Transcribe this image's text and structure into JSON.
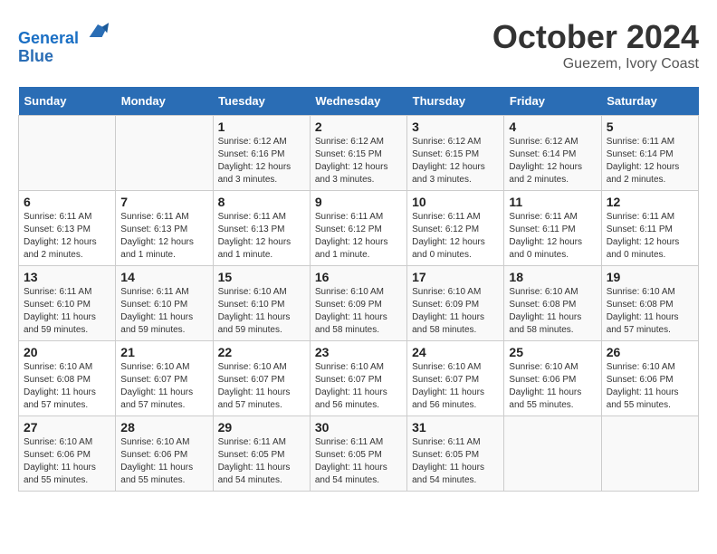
{
  "header": {
    "logo_line1": "General",
    "logo_line2": "Blue",
    "month": "October 2024",
    "location": "Guezem, Ivory Coast"
  },
  "weekdays": [
    "Sunday",
    "Monday",
    "Tuesday",
    "Wednesday",
    "Thursday",
    "Friday",
    "Saturday"
  ],
  "weeks": [
    [
      {
        "day": "",
        "sunrise": "",
        "sunset": "",
        "daylight": ""
      },
      {
        "day": "",
        "sunrise": "",
        "sunset": "",
        "daylight": ""
      },
      {
        "day": "1",
        "sunrise": "Sunrise: 6:12 AM",
        "sunset": "Sunset: 6:16 PM",
        "daylight": "Daylight: 12 hours and 3 minutes."
      },
      {
        "day": "2",
        "sunrise": "Sunrise: 6:12 AM",
        "sunset": "Sunset: 6:15 PM",
        "daylight": "Daylight: 12 hours and 3 minutes."
      },
      {
        "day": "3",
        "sunrise": "Sunrise: 6:12 AM",
        "sunset": "Sunset: 6:15 PM",
        "daylight": "Daylight: 12 hours and 3 minutes."
      },
      {
        "day": "4",
        "sunrise": "Sunrise: 6:12 AM",
        "sunset": "Sunset: 6:14 PM",
        "daylight": "Daylight: 12 hours and 2 minutes."
      },
      {
        "day": "5",
        "sunrise": "Sunrise: 6:11 AM",
        "sunset": "Sunset: 6:14 PM",
        "daylight": "Daylight: 12 hours and 2 minutes."
      }
    ],
    [
      {
        "day": "6",
        "sunrise": "Sunrise: 6:11 AM",
        "sunset": "Sunset: 6:13 PM",
        "daylight": "Daylight: 12 hours and 2 minutes."
      },
      {
        "day": "7",
        "sunrise": "Sunrise: 6:11 AM",
        "sunset": "Sunset: 6:13 PM",
        "daylight": "Daylight: 12 hours and 1 minute."
      },
      {
        "day": "8",
        "sunrise": "Sunrise: 6:11 AM",
        "sunset": "Sunset: 6:13 PM",
        "daylight": "Daylight: 12 hours and 1 minute."
      },
      {
        "day": "9",
        "sunrise": "Sunrise: 6:11 AM",
        "sunset": "Sunset: 6:12 PM",
        "daylight": "Daylight: 12 hours and 1 minute."
      },
      {
        "day": "10",
        "sunrise": "Sunrise: 6:11 AM",
        "sunset": "Sunset: 6:12 PM",
        "daylight": "Daylight: 12 hours and 0 minutes."
      },
      {
        "day": "11",
        "sunrise": "Sunrise: 6:11 AM",
        "sunset": "Sunset: 6:11 PM",
        "daylight": "Daylight: 12 hours and 0 minutes."
      },
      {
        "day": "12",
        "sunrise": "Sunrise: 6:11 AM",
        "sunset": "Sunset: 6:11 PM",
        "daylight": "Daylight: 12 hours and 0 minutes."
      }
    ],
    [
      {
        "day": "13",
        "sunrise": "Sunrise: 6:11 AM",
        "sunset": "Sunset: 6:10 PM",
        "daylight": "Daylight: 11 hours and 59 minutes."
      },
      {
        "day": "14",
        "sunrise": "Sunrise: 6:11 AM",
        "sunset": "Sunset: 6:10 PM",
        "daylight": "Daylight: 11 hours and 59 minutes."
      },
      {
        "day": "15",
        "sunrise": "Sunrise: 6:10 AM",
        "sunset": "Sunset: 6:10 PM",
        "daylight": "Daylight: 11 hours and 59 minutes."
      },
      {
        "day": "16",
        "sunrise": "Sunrise: 6:10 AM",
        "sunset": "Sunset: 6:09 PM",
        "daylight": "Daylight: 11 hours and 58 minutes."
      },
      {
        "day": "17",
        "sunrise": "Sunrise: 6:10 AM",
        "sunset": "Sunset: 6:09 PM",
        "daylight": "Daylight: 11 hours and 58 minutes."
      },
      {
        "day": "18",
        "sunrise": "Sunrise: 6:10 AM",
        "sunset": "Sunset: 6:08 PM",
        "daylight": "Daylight: 11 hours and 58 minutes."
      },
      {
        "day": "19",
        "sunrise": "Sunrise: 6:10 AM",
        "sunset": "Sunset: 6:08 PM",
        "daylight": "Daylight: 11 hours and 57 minutes."
      }
    ],
    [
      {
        "day": "20",
        "sunrise": "Sunrise: 6:10 AM",
        "sunset": "Sunset: 6:08 PM",
        "daylight": "Daylight: 11 hours and 57 minutes."
      },
      {
        "day": "21",
        "sunrise": "Sunrise: 6:10 AM",
        "sunset": "Sunset: 6:07 PM",
        "daylight": "Daylight: 11 hours and 57 minutes."
      },
      {
        "day": "22",
        "sunrise": "Sunrise: 6:10 AM",
        "sunset": "Sunset: 6:07 PM",
        "daylight": "Daylight: 11 hours and 57 minutes."
      },
      {
        "day": "23",
        "sunrise": "Sunrise: 6:10 AM",
        "sunset": "Sunset: 6:07 PM",
        "daylight": "Daylight: 11 hours and 56 minutes."
      },
      {
        "day": "24",
        "sunrise": "Sunrise: 6:10 AM",
        "sunset": "Sunset: 6:07 PM",
        "daylight": "Daylight: 11 hours and 56 minutes."
      },
      {
        "day": "25",
        "sunrise": "Sunrise: 6:10 AM",
        "sunset": "Sunset: 6:06 PM",
        "daylight": "Daylight: 11 hours and 55 minutes."
      },
      {
        "day": "26",
        "sunrise": "Sunrise: 6:10 AM",
        "sunset": "Sunset: 6:06 PM",
        "daylight": "Daylight: 11 hours and 55 minutes."
      }
    ],
    [
      {
        "day": "27",
        "sunrise": "Sunrise: 6:10 AM",
        "sunset": "Sunset: 6:06 PM",
        "daylight": "Daylight: 11 hours and 55 minutes."
      },
      {
        "day": "28",
        "sunrise": "Sunrise: 6:10 AM",
        "sunset": "Sunset: 6:06 PM",
        "daylight": "Daylight: 11 hours and 55 minutes."
      },
      {
        "day": "29",
        "sunrise": "Sunrise: 6:11 AM",
        "sunset": "Sunset: 6:05 PM",
        "daylight": "Daylight: 11 hours and 54 minutes."
      },
      {
        "day": "30",
        "sunrise": "Sunrise: 6:11 AM",
        "sunset": "Sunset: 6:05 PM",
        "daylight": "Daylight: 11 hours and 54 minutes."
      },
      {
        "day": "31",
        "sunrise": "Sunrise: 6:11 AM",
        "sunset": "Sunset: 6:05 PM",
        "daylight": "Daylight: 11 hours and 54 minutes."
      },
      {
        "day": "",
        "sunrise": "",
        "sunset": "",
        "daylight": ""
      },
      {
        "day": "",
        "sunrise": "",
        "sunset": "",
        "daylight": ""
      }
    ]
  ]
}
